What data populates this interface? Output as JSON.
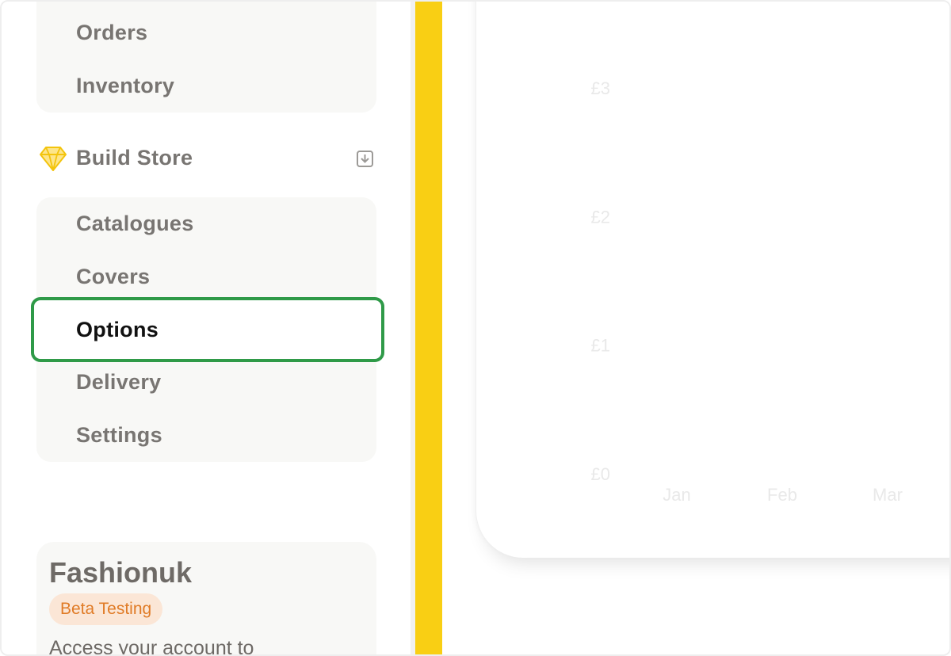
{
  "sidebar": {
    "top_items": [
      {
        "label": "Orders"
      },
      {
        "label": "Inventory"
      }
    ],
    "section": {
      "title": "Build Store",
      "icon": "diamond-icon",
      "icon_color": "#f9cf14",
      "toggle_icon": "collapse-arrow-icon"
    },
    "build_items": [
      {
        "label": "Catalogues"
      },
      {
        "label": "Covers"
      },
      {
        "label": "Options",
        "active": true
      },
      {
        "label": "Delivery"
      },
      {
        "label": "Settings"
      }
    ],
    "account": {
      "name": "Fashionuk",
      "badge": "Beta Testing",
      "description": "Access your account to"
    }
  },
  "colors": {
    "accent_yellow": "#f9cf14",
    "active_outline": "#2f9a48",
    "badge_bg": "#fbe6d6",
    "badge_text": "#e07b26"
  },
  "chart_data": {
    "type": "bar",
    "categories": [
      "Jan",
      "Feb",
      "Mar"
    ],
    "y_ticks": [
      "£0",
      "£1",
      "£2",
      "£3"
    ],
    "ylim": [
      0,
      3
    ],
    "values": [
      0,
      0,
      0
    ],
    "title": "",
    "xlabel": "",
    "ylabel": ""
  }
}
